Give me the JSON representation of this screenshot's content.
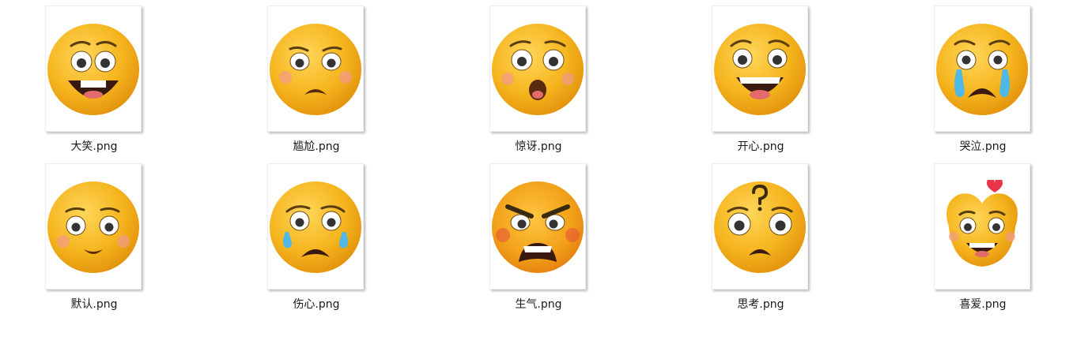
{
  "files": [
    {
      "name": "大笑.png",
      "icon": "laughing-emoji-icon"
    },
    {
      "name": "尴尬.png",
      "icon": "embarrassed-emoji-icon"
    },
    {
      "name": "惊讶.png",
      "icon": "surprised-emoji-icon"
    },
    {
      "name": "开心.png",
      "icon": "happy-emoji-icon"
    },
    {
      "name": "哭泣.png",
      "icon": "crying-emoji-icon"
    },
    {
      "name": "默认.png",
      "icon": "default-emoji-icon"
    },
    {
      "name": "伤心.png",
      "icon": "sad-emoji-icon"
    },
    {
      "name": "生气.png",
      "icon": "angry-emoji-icon"
    },
    {
      "name": "思考.png",
      "icon": "thinking-emoji-icon"
    },
    {
      "name": "喜爱.png",
      "icon": "love-emoji-icon"
    }
  ],
  "colors": {
    "face": "#f5b51e",
    "face_shade": "#e2910c",
    "tear": "#4fb8e6",
    "blush": "#f29a8c",
    "heart": "#e8354a"
  }
}
